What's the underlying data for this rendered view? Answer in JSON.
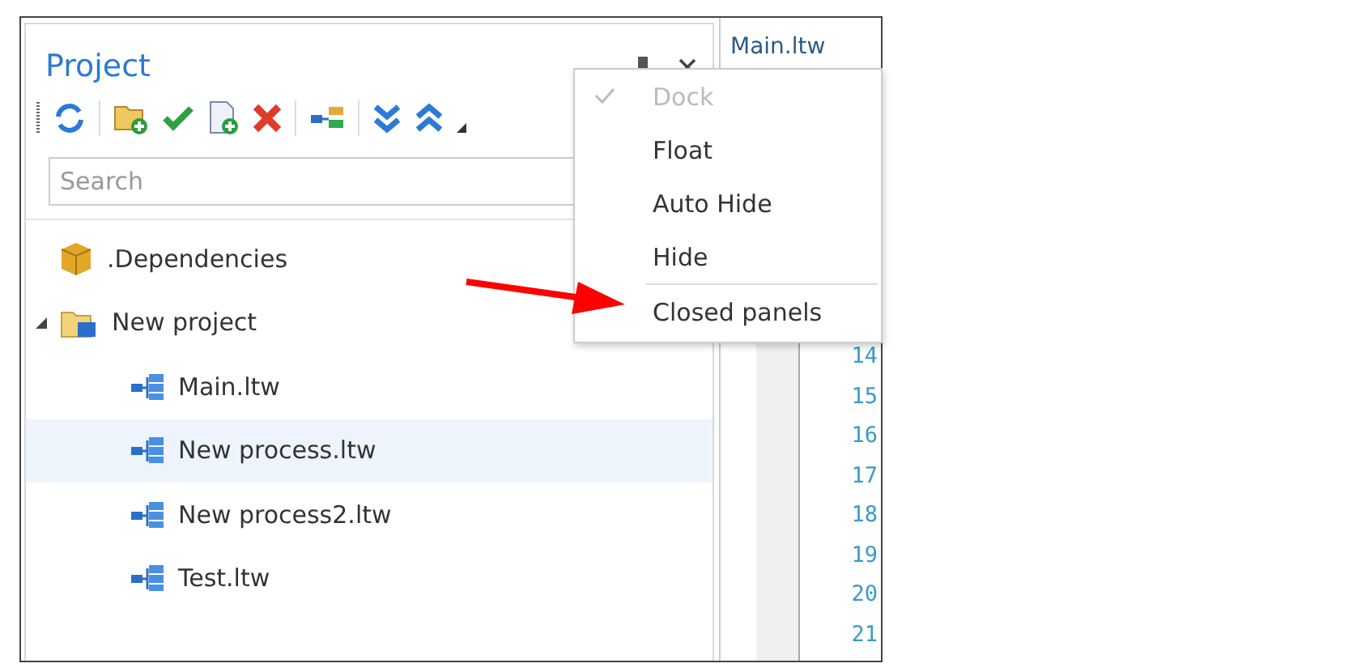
{
  "panel": {
    "title": "Project",
    "search": {
      "placeholder": "Search"
    },
    "tree": [
      {
        "label": ".Dependencies",
        "kind": "package",
        "selected": false
      },
      {
        "label": "New project",
        "kind": "project",
        "expanded": true,
        "selected": false,
        "children": [
          {
            "label": "Main.ltw",
            "kind": "process",
            "selected": false
          },
          {
            "label": "New process.ltw",
            "kind": "process",
            "selected": true
          },
          {
            "label": "New process2.ltw",
            "kind": "process",
            "selected": false
          },
          {
            "label": "Test.ltw",
            "kind": "process",
            "selected": false
          }
        ]
      }
    ]
  },
  "editor": {
    "tab": "Main.ltw",
    "line_numbers": [
      "14",
      "15",
      "16",
      "17",
      "18",
      "19",
      "20",
      "21"
    ]
  },
  "menu": [
    {
      "label": "Dock",
      "checked": true,
      "disabled": true,
      "separator_before": false
    },
    {
      "label": "Float",
      "checked": false,
      "disabled": false,
      "separator_before": false
    },
    {
      "label": "Auto Hide",
      "checked": false,
      "disabled": false,
      "separator_before": false
    },
    {
      "label": "Hide",
      "checked": false,
      "disabled": false,
      "separator_before": false
    },
    {
      "label": "Closed panels",
      "checked": false,
      "disabled": false,
      "separator_before": true
    }
  ]
}
